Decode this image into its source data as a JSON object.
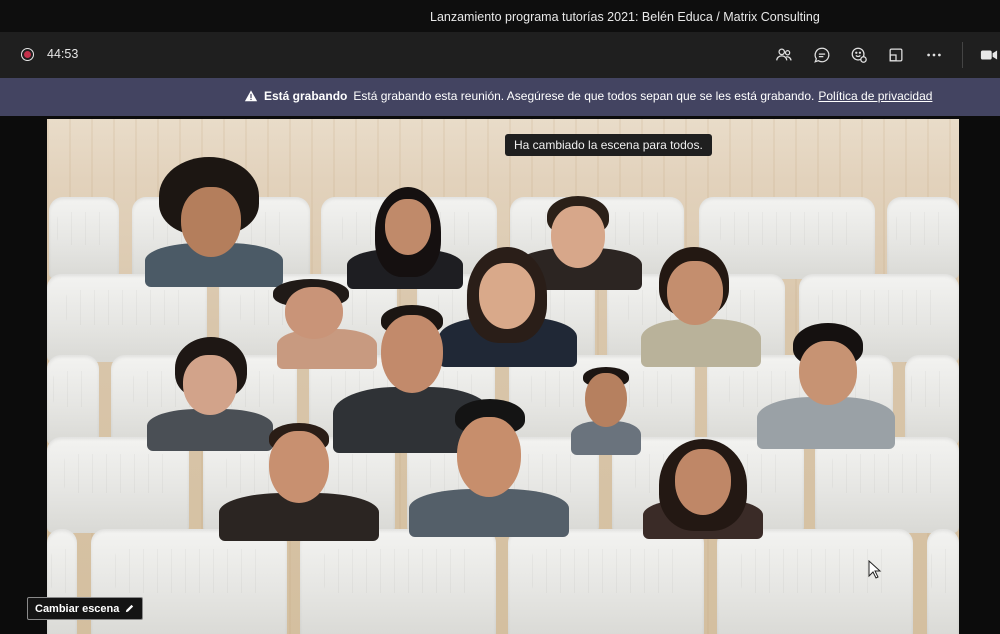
{
  "window": {
    "title": "Lanzamiento programa tutorías 2021: Belén Educa / Matrix Consulting"
  },
  "toolbar": {
    "timer": "44:53",
    "icons": [
      "recording-dot-icon",
      "people-icon",
      "chat-icon",
      "reactions-icon",
      "rooms-icon",
      "more-icon",
      "camera-icon"
    ]
  },
  "banner": {
    "title": "Está grabando",
    "message": "Está grabando esta reunión. Asegúrese de que todos sepan que se les está grabando.",
    "link": "Política de privacidad"
  },
  "toast": {
    "text": "Ha cambiado la escena para todos."
  },
  "scene_button": {
    "label": "Cambiar escena"
  },
  "colors": {
    "banner_bg": "#434461",
    "titlebar_bg": "#0e0e0e",
    "toolbar_bg": "#1f1f1f",
    "recording": "#c4314b"
  }
}
